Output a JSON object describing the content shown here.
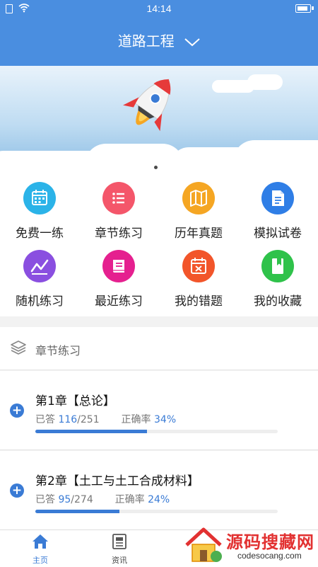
{
  "status_bar": {
    "time": "14:14"
  },
  "header": {
    "title": "道路工程"
  },
  "banner": {
    "slide_count": 3,
    "active_slide": 1
  },
  "grid": [
    {
      "label": "免费一练",
      "icon": "calendar-icon",
      "color": "#2bb3e8"
    },
    {
      "label": "章节练习",
      "icon": "list-icon",
      "color": "#f4566a"
    },
    {
      "label": "历年真题",
      "icon": "map-icon",
      "color": "#f5a623"
    },
    {
      "label": "模拟试卷",
      "icon": "document-icon",
      "color": "#2f7ee6"
    },
    {
      "label": "随机练习",
      "icon": "trend-icon",
      "color": "#8a4fe0"
    },
    {
      "label": "最近练习",
      "icon": "book-icon",
      "color": "#e5208f"
    },
    {
      "label": "我的错题",
      "icon": "error-calendar-icon",
      "color": "#f2552a"
    },
    {
      "label": "我的收藏",
      "icon": "bookmark-icon",
      "color": "#2fc24a"
    }
  ],
  "section": {
    "title": "章节练习",
    "icon": "layers-icon"
  },
  "chapters": [
    {
      "name": "第1章【总论】",
      "answered_label": "已答",
      "answered": "116",
      "total": "/251",
      "accuracy_label": "正确率",
      "accuracy": "34%",
      "progress": 0.462
    },
    {
      "name": "第2章【土工与土工合成材料】",
      "answered_label": "已答",
      "answered": "95",
      "total": "/274",
      "accuracy_label": "正确率",
      "accuracy": "24%",
      "progress": 0.347
    }
  ],
  "bottom_nav": [
    {
      "label": "主页",
      "icon": "home-icon",
      "active": true
    },
    {
      "label": "资讯",
      "icon": "news-icon",
      "active": false
    }
  ],
  "watermark": {
    "title": "源码搜藏网",
    "url": "codesocang.com"
  },
  "colors": {
    "primary": "#4a8ee0",
    "accent": "#3a7bd5"
  }
}
